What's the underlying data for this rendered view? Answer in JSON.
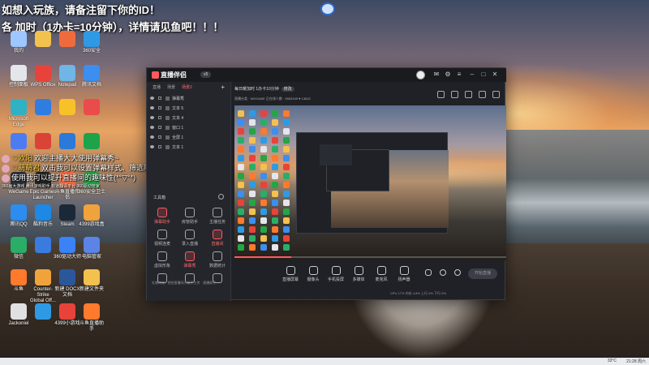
{
  "banner": {
    "line1": "如想入玩族，请备注留下你的ID！",
    "line2": "各      加时（1办卡=10分钟），详情请见鱼吧！！！"
  },
  "desktop_icons": [
    {
      "label": "我的",
      "color": "#9ec7ff"
    },
    {
      "label": "",
      "color": "#f2c14e"
    },
    {
      "label": "",
      "color": "#f06b3c"
    },
    {
      "label": "360安全",
      "color": "#2e9ae5"
    },
    {
      "label": "控制面板",
      "color": "#e3e6ea"
    },
    {
      "label": "WPS Office",
      "color": "#e8433a"
    },
    {
      "label": "Notepad",
      "color": "#6fb5e6"
    },
    {
      "label": "腾讯文档",
      "color": "#3c8ef0"
    },
    {
      "label": "Microsoft Edge",
      "color": "#2fb1c6"
    },
    {
      "label": "",
      "color": "#2f7de1"
    },
    {
      "label": "",
      "color": "#f7c12a"
    },
    {
      "label": "",
      "color": "#ea4b4b"
    },
    {
      "label": "",
      "color": "#4d7cf2"
    },
    {
      "label": "",
      "color": "#d94436"
    },
    {
      "label": "",
      "color": "#2b79d9"
    },
    {
      "label": "",
      "color": "#1ea34b"
    },
    {
      "label": "WeGame",
      "color": "#2b2f36"
    },
    {
      "label": "Epic Games Launcher",
      "color": "#222"
    },
    {
      "label": "斗鱼直播伴侣",
      "color": "#ff6a3c"
    },
    {
      "label": "360安全卫士",
      "color": "#25a546"
    },
    {
      "label": "腾讯QQ",
      "color": "#2d8cf0"
    },
    {
      "label": "酷狗音乐",
      "color": "#1e88e5"
    },
    {
      "label": "Steam",
      "color": "#1b2838"
    },
    {
      "label": "4399游戏盒",
      "color": "#f0a33c"
    },
    {
      "label": "微信",
      "color": "#2aae67"
    },
    {
      "label": "",
      "color": "#3a7be0"
    },
    {
      "label": "360驱动大师",
      "color": "#3b82f6"
    },
    {
      "label": "电脑管家",
      "color": "#5c84e6"
    },
    {
      "label": "斗鱼",
      "color": "#ff7a2c"
    },
    {
      "label": "Counter-Strike Global Off...",
      "color": "#f0a33c"
    },
    {
      "label": "新建 DOCX 文档",
      "color": "#2b579a"
    },
    {
      "label": "新建文件夹",
      "color": "#f2c14e"
    },
    {
      "label": "Jackoniel",
      "color": "#e0e0e0"
    },
    {
      "label": "",
      "color": "#2e9ae5"
    },
    {
      "label": "4399小游戏",
      "color": "#e8433a"
    },
    {
      "label": "斗鱼直播助手",
      "color": "#ff7a2c"
    }
  ],
  "chat": [
    {
      "nick": "♡欧阳",
      "text": "欢迎主播大大使用弹幕秀~",
      "pre": "♡"
    },
    {
      "nick": "♡萌萌君",
      "text": "双击我可以设置弹幕样式、筛选展示哦~",
      "pre": ""
    },
    {
      "nick": "",
      "text": "使用我可以提升直播间的趣味性(*°▽°*)",
      "pre": ""
    }
  ],
  "chat_tail": "360画大游戏  腾讯游戏助手  有道翻译平台  360驱动管家",
  "app": {
    "name": "直播伴侣",
    "version": "v5",
    "left_tabs": [
      "直播",
      "场景",
      "场景2"
    ],
    "active_tab": 2,
    "layers": [
      "弹幕秀",
      "文本 5",
      "文本 4",
      "窗口 1",
      "全屏 1",
      "文本 1"
    ],
    "tools_title": "工具箱",
    "tools": [
      {
        "label": "弹幕助手",
        "red": true
      },
      {
        "label": "房管助手",
        "red": false
      },
      {
        "label": "主播任务",
        "red": false
      },
      {
        "label": "视频连麦",
        "red": false
      },
      {
        "label": "录入直播",
        "red": false
      },
      {
        "label": "直播间",
        "red": true
      },
      {
        "label": "虚拟形象",
        "red": false
      },
      {
        "label": "弹幕秀",
        "red": true
      },
      {
        "label": "数据统计",
        "red": false
      },
      {
        "label": "",
        "red": false
      },
      {
        "label": "",
        "red": false
      },
      {
        "label": "",
        "red": false
      }
    ],
    "left_footer": "礼物特效 · 把控直播间小助手上传 · 直播助手",
    "stream_title": "每日暖加时 1办卡10分钟",
    "edit_badge": "修改",
    "sub_info": "直播分类 · WEGAME    正在线人数 · 5983349    ♥ 13632",
    "controls": [
      "直播屏幕",
      "摄像头",
      "手机投屏",
      "多媒体",
      "麦克风",
      "扬声器"
    ],
    "go_live": "开始直播",
    "right_footer": "CPU 17%   内存 4.8%   上行 0%   下行 0%"
  },
  "taskbar": {
    "temp": "33°C",
    "time": "21:28 周六"
  }
}
